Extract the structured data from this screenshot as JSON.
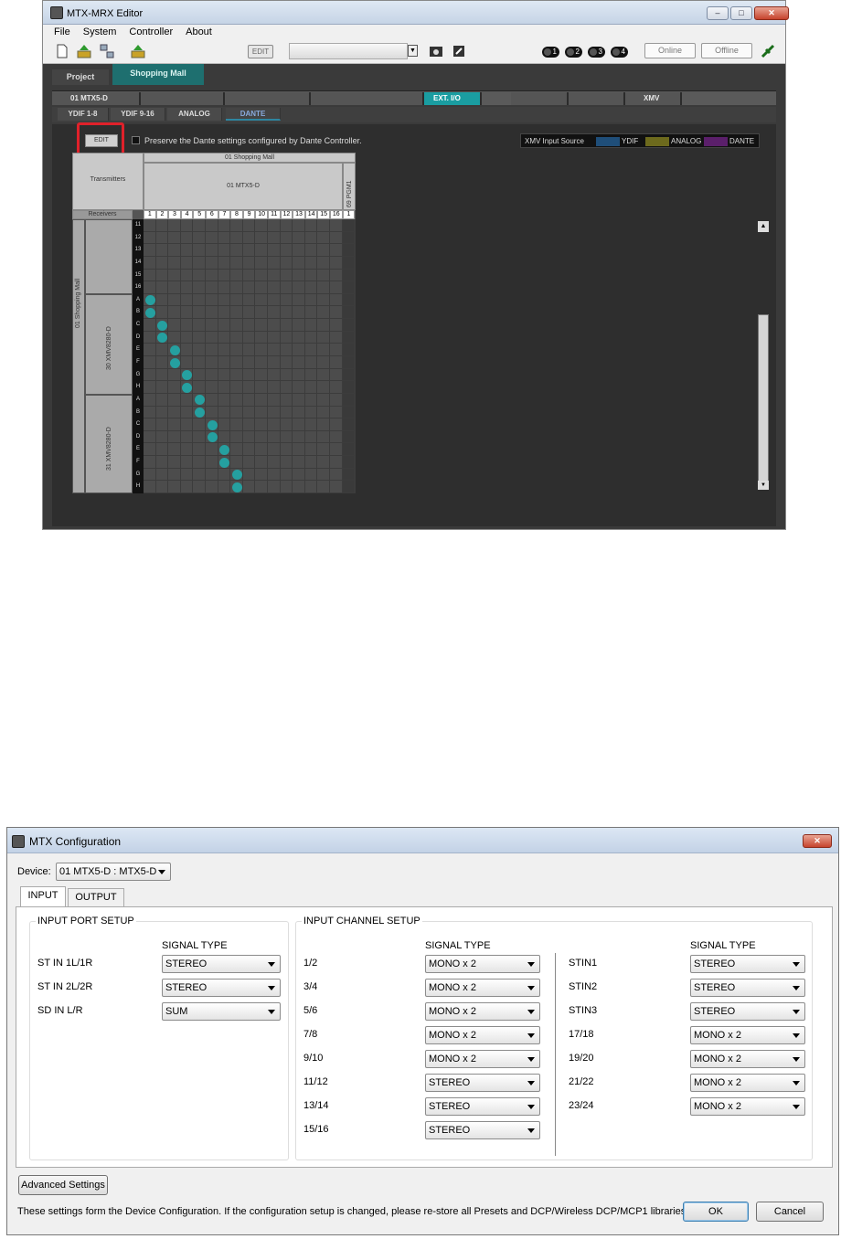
{
  "editor": {
    "title": "MTX-MRX Editor",
    "menu": [
      "File",
      "System",
      "Controller",
      "About"
    ],
    "edit_label": "EDIT",
    "badges": [
      "1",
      "2",
      "3",
      "4"
    ],
    "online": "Online",
    "offline": "Offline",
    "project_tab": "Project",
    "system_tab": "Shopping Mall",
    "devices": [
      "01 MTX5-D",
      "",
      "",
      "",
      "EXT. I/O",
      "",
      "",
      "XMV",
      ""
    ],
    "subtabs": [
      "YDIF 1-8",
      "YDIF 9-16",
      "ANALOG",
      "DANTE"
    ],
    "edit_button": "EDIT",
    "preserve_label": "Preserve the Dante settings configured by Dante Controller.",
    "legend": {
      "title": "XMV Input Source",
      "items": [
        {
          "label": "YDIF",
          "color": "#1f4e79"
        },
        {
          "label": "ANALOG",
          "color": "#6d6a1d"
        },
        {
          "label": "DANTE",
          "color": "#5b1f6b"
        }
      ]
    },
    "matrix": {
      "system_label": "01 Shopping Mall",
      "transmitters_label": "Transmitters",
      "tx_device": "01 MTX5-D",
      "tx_device2": "69 PGM1",
      "receivers_label": "Receivers",
      "rx_system": "01 Shopping Mall",
      "rx_device1": "30 XMV8280-D",
      "rx_device2": "31 XMV8280-D",
      "columns": [
        "1",
        "2",
        "3",
        "4",
        "5",
        "6",
        "7",
        "8",
        "9",
        "10",
        "11",
        "12",
        "13",
        "14",
        "15",
        "16",
        "1"
      ],
      "rows": [
        "11",
        "12",
        "13",
        "14",
        "15",
        "16",
        "A",
        "B",
        "C",
        "D",
        "E",
        "F",
        "G",
        "H",
        "A",
        "B",
        "C",
        "D",
        "E",
        "F",
        "G",
        "H"
      ],
      "patches": [
        [
          0,
          6
        ],
        [
          0,
          7
        ],
        [
          1,
          8
        ],
        [
          1,
          9
        ],
        [
          2,
          10
        ],
        [
          2,
          11
        ],
        [
          3,
          12
        ],
        [
          3,
          13
        ],
        [
          4,
          14
        ],
        [
          4,
          15
        ],
        [
          5,
          16
        ],
        [
          5,
          17
        ],
        [
          6,
          18
        ],
        [
          6,
          19
        ],
        [
          7,
          20
        ],
        [
          7,
          21
        ]
      ]
    }
  },
  "config": {
    "title": "MTX Configuration",
    "device_label": "Device:",
    "device_value": "01 MTX5-D : MTX5-D",
    "tabs": [
      "INPUT",
      "OUTPUT"
    ],
    "port_setup": {
      "title": "INPUT PORT SETUP",
      "header": "SIGNAL TYPE",
      "rows": [
        {
          "label": "ST IN 1L/1R",
          "value": "STEREO"
        },
        {
          "label": "ST IN 2L/2R",
          "value": "STEREO"
        },
        {
          "label": "SD IN L/R",
          "value": "SUM"
        }
      ]
    },
    "channel_setup": {
      "title": "INPUT CHANNEL SETUP",
      "header": "SIGNAL TYPE",
      "left": [
        {
          "label": "1/2",
          "value": "MONO x 2"
        },
        {
          "label": "3/4",
          "value": "MONO x 2"
        },
        {
          "label": "5/6",
          "value": "MONO x 2"
        },
        {
          "label": "7/8",
          "value": "MONO x 2"
        },
        {
          "label": "9/10",
          "value": "MONO x 2"
        },
        {
          "label": "11/12",
          "value": "STEREO"
        },
        {
          "label": "13/14",
          "value": "STEREO"
        },
        {
          "label": "15/16",
          "value": "STEREO"
        }
      ],
      "right": [
        {
          "label": "STIN1",
          "value": "STEREO"
        },
        {
          "label": "STIN2",
          "value": "STEREO"
        },
        {
          "label": "STIN3",
          "value": "STEREO"
        },
        {
          "label": "17/18",
          "value": "MONO x 2"
        },
        {
          "label": "19/20",
          "value": "MONO x 2"
        },
        {
          "label": "21/22",
          "value": "MONO x 2"
        },
        {
          "label": "23/24",
          "value": "MONO x 2"
        }
      ]
    },
    "advanced_button": "Advanced Settings",
    "footer_note": "These settings form the Device Configuration. If the configuration setup is changed, please re-store all Presets and DCP/Wireless DCP/MCP1 libraries.",
    "ok": "OK",
    "cancel": "Cancel"
  }
}
